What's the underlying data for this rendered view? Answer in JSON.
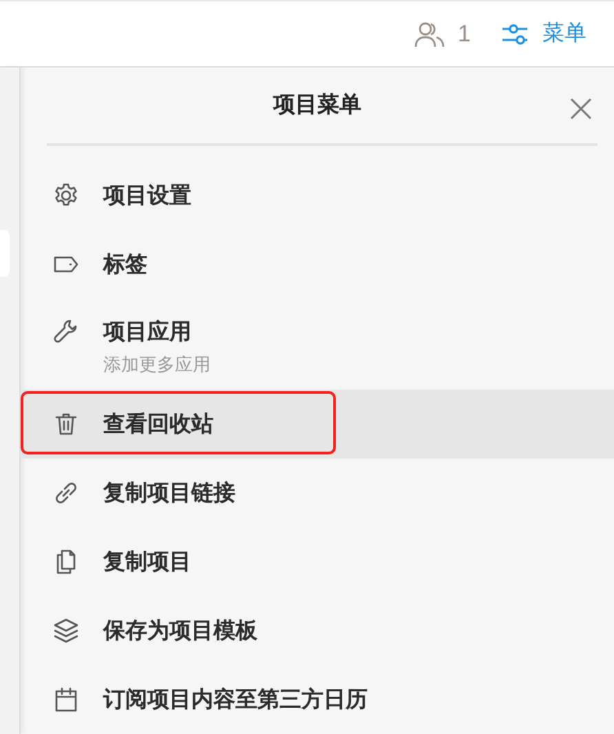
{
  "top_bar": {
    "members_count": "1",
    "menu_button": "菜单"
  },
  "panel": {
    "title": "项目菜单",
    "items": [
      {
        "kind": "gear",
        "label": "项目设置",
        "selected": false,
        "outlined": false
      },
      {
        "kind": "tag",
        "label": "标签",
        "selected": false,
        "outlined": false
      },
      {
        "kind": "wrench",
        "label": "项目应用",
        "sublabel": "添加更多应用",
        "selected": false,
        "outlined": false
      },
      {
        "kind": "trash",
        "label": "查看回收站",
        "selected": true,
        "outlined": true
      },
      {
        "kind": "link",
        "label": "复制项目链接",
        "selected": false,
        "outlined": false
      },
      {
        "kind": "copy",
        "label": "复制项目",
        "selected": false,
        "outlined": false
      },
      {
        "kind": "layers",
        "label": "保存为项目模板",
        "selected": false,
        "outlined": false
      },
      {
        "kind": "calendar",
        "label": "订阅项目内容至第三方日历",
        "selected": false,
        "outlined": false
      }
    ]
  }
}
